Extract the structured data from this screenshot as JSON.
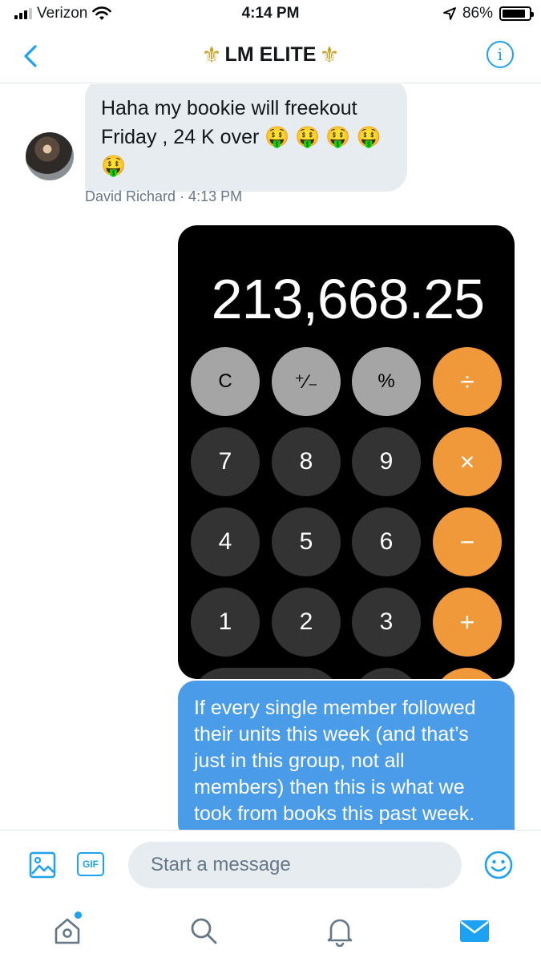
{
  "status_bar": {
    "carrier": "Verizon",
    "time": "4:14 PM",
    "battery_percent": "86%",
    "battery_level": 0.86
  },
  "header": {
    "title": "LM ELITE",
    "title_decoration": "⚜"
  },
  "messages": {
    "incoming": {
      "text": "Haha my bookie will freekout Friday , 24 K over 🤑 🤑 🤑 🤑 🤑",
      "sender": "David Richard",
      "time": "· 4:13 PM"
    },
    "calculator": {
      "display": "213,668.25",
      "keys": [
        "C",
        "⁺∕₋",
        "%",
        "÷",
        "7",
        "8",
        "9",
        "×",
        "4",
        "5",
        "6",
        "−",
        "1",
        "2",
        "3",
        "+"
      ]
    },
    "outgoing": {
      "text": "If every single member followed their units this week (and that’s just in this group, not all members) then this is what we took from books this past week."
    }
  },
  "composer": {
    "gif_label": "GIF",
    "placeholder": "Start a message"
  },
  "colors": {
    "accent": "#1da1f2",
    "outgoing_bubble": "#4a9ce8",
    "incoming_bubble": "#e6ecf0",
    "calc_operator": "#f0993b"
  }
}
